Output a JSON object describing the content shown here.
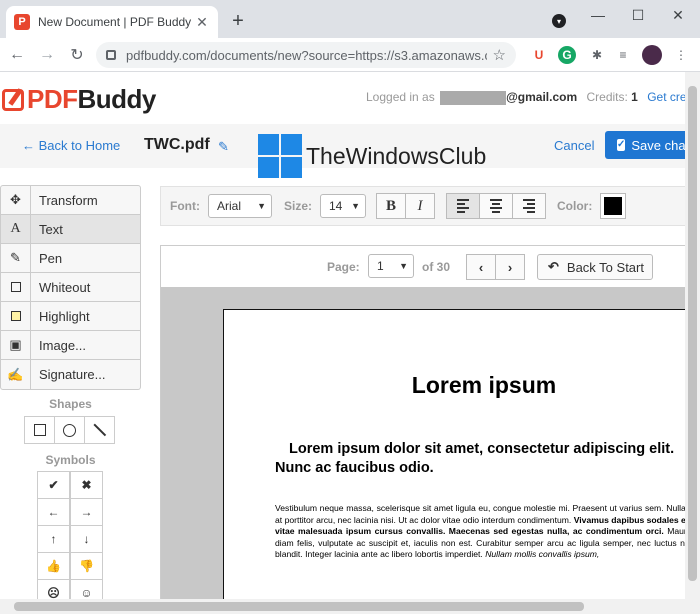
{
  "browser": {
    "tab_title": "New Document | PDF Buddy",
    "tab_favicon_letter": "P",
    "url": "pdfbuddy.com/documents/new?source=https://s3.amazonaws.c..."
  },
  "header": {
    "logo_pdf": "PDF",
    "logo_buddy": "Buddy",
    "logged_in_as": "Logged in as",
    "email_visible": "@gmail.com",
    "credits_label": "Credits:",
    "credits_value": "1",
    "get_credits": "Get cre"
  },
  "subbar": {
    "back_label": "← Back to Home",
    "doc_title": "TWC.pdf",
    "watermark_text": "TheWindowsClub",
    "cancel_label": "Cancel",
    "save_label": "Save cha"
  },
  "tools": [
    {
      "label": "Transform",
      "icon": "move-icon",
      "glyph": "✥"
    },
    {
      "label": "Text",
      "icon": "text-icon",
      "glyph": "A"
    },
    {
      "label": "Pen",
      "icon": "pen-icon",
      "glyph": "✎"
    },
    {
      "label": "Whiteout",
      "icon": "whiteout-icon",
      "glyph": ""
    },
    {
      "label": "Highlight",
      "icon": "highlight-icon",
      "glyph": ""
    },
    {
      "label": "Image...",
      "icon": "image-icon",
      "glyph": "▣"
    },
    {
      "label": "Signature...",
      "icon": "signature-icon",
      "glyph": "✍"
    }
  ],
  "active_tool": "Text",
  "shapes_label": "Shapes",
  "symbols_label": "Symbols",
  "symbols": [
    "✔",
    "✖",
    "←",
    "→",
    "↑",
    "↓",
    "👍",
    "👎",
    "☹",
    "☺"
  ],
  "format": {
    "font_label": "Font:",
    "font_value": "Arial",
    "size_label": "Size:",
    "size_value": "14",
    "bold": "B",
    "italic": "I",
    "color_label": "Color:",
    "color_value": "#000000"
  },
  "pager": {
    "page_label": "Page:",
    "page_value": "1",
    "of_total": "of 30",
    "back_to_start": "Back To Start"
  },
  "document": {
    "heading": "Lorem ipsum",
    "subheading": "Lorem ipsum dolor sit amet, consectetur adipiscing elit. Nunc ac faucibus odio.",
    "body_1": "Vestibulum neque massa, scelerisque sit amet ligula eu, congue molestie mi. Praesent ut varius sem. Nullam at porttitor arcu, nec lacinia nisi. Ut ac dolor vitae odio interdum condimentum. ",
    "body_bold": "Vivamus dapibus sodales ex, vitae malesuada ipsum cursus convallis. Maecenas sed egestas nulla, ac condimentum orci.",
    "body_2": " Mauris diam felis, vulputate ac suscipit et, iaculis non est. Curabitur semper arcu ac ligula semper, nec luctus nisl blandit. Integer lacinia ante ac libero lobortis imperdiet. ",
    "body_italic": "Nullam mollis convallis ipsum,"
  }
}
